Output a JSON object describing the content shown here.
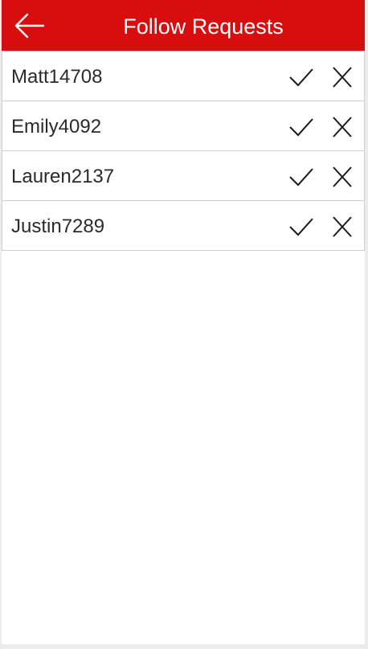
{
  "header": {
    "title": "Follow Requests",
    "back_icon": "arrow-left-icon",
    "background": "#d80e0e"
  },
  "requests": [
    {
      "username": "Matt14708"
    },
    {
      "username": "Emily4092"
    },
    {
      "username": "Lauren2137"
    },
    {
      "username": "Justin7289"
    }
  ],
  "actions": {
    "accept_icon": "checkmark-icon",
    "reject_icon": "close-icon"
  }
}
